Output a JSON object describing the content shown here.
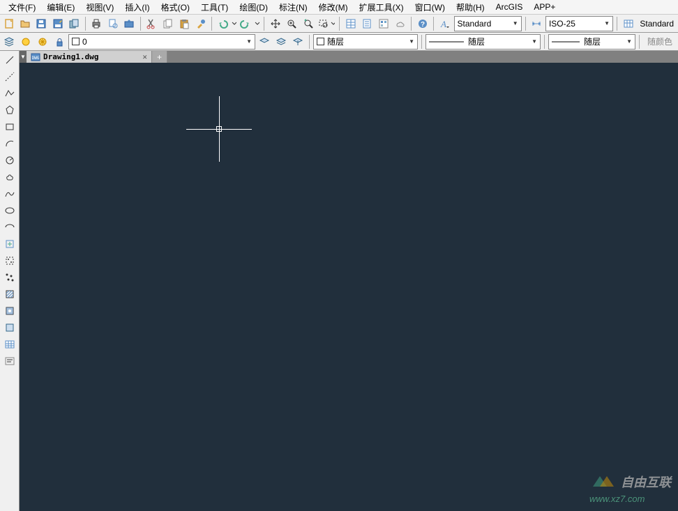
{
  "menu": {
    "file": "文件(F)",
    "edit": "编辑(E)",
    "view": "视图(V)",
    "insert": "插入(I)",
    "format": "格式(O)",
    "tools": "工具(T)",
    "draw": "绘图(D)",
    "annotate": "标注(N)",
    "modify": "修改(M)",
    "extend": "扩展工具(X)",
    "window": "窗口(W)",
    "help": "帮助(H)",
    "arcgis": "ArcGIS",
    "app": "APP+"
  },
  "toolbar": {
    "text_style": "Standard",
    "dim_style": "ISO-25",
    "table_style": "Standard"
  },
  "props": {
    "layer": "0",
    "color_label": "随层",
    "linetype": "随层",
    "lineweight": "随层",
    "print_style": "随颜色"
  },
  "tab": {
    "filename": "Drawing1.dwg"
  },
  "watermark": {
    "text": "自由互联",
    "url": "www.xz7.com"
  },
  "icons": {
    "new": "new-file",
    "open": "open-folder",
    "save": "save-disk",
    "saveas": "save-as",
    "copy-doc": "copy-doc",
    "print": "print",
    "preview": "print-preview",
    "publish": "publish",
    "cut": "cut",
    "copy": "copy",
    "paste": "paste",
    "matchprops": "match-props",
    "undo": "undo",
    "redo": "redo",
    "pan": "pan-hand",
    "zoom": "zoom-realtime",
    "zoom-prev": "zoom-prev",
    "zoom-win": "zoom-window",
    "prop-palette": "properties",
    "sheet": "sheet-set",
    "tool-palette": "tool-palette",
    "cloud": "cloud",
    "help": "help"
  },
  "left_tools": [
    "line",
    "construction-line",
    "polyline",
    "polygon",
    "rectangle",
    "arc",
    "circle-rev",
    "cloud",
    "spline",
    "ellipse",
    "ellipse-arc",
    "insert-block",
    "make-block",
    "point",
    "hatch",
    "gradient",
    "region",
    "table-icon",
    "text-icon"
  ]
}
